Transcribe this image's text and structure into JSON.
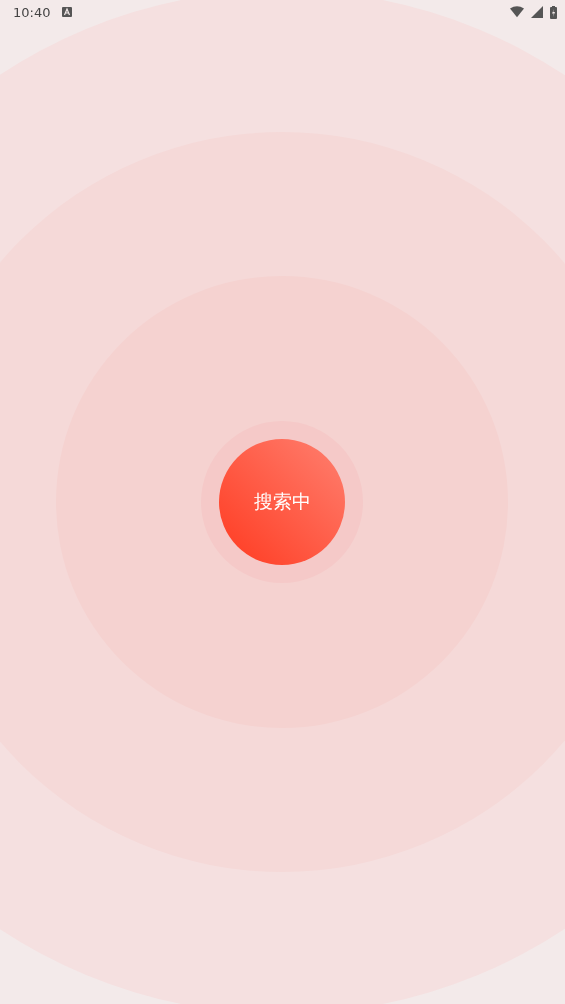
{
  "status_bar": {
    "time": "10:40"
  },
  "search_button": {
    "label": "搜索中"
  }
}
